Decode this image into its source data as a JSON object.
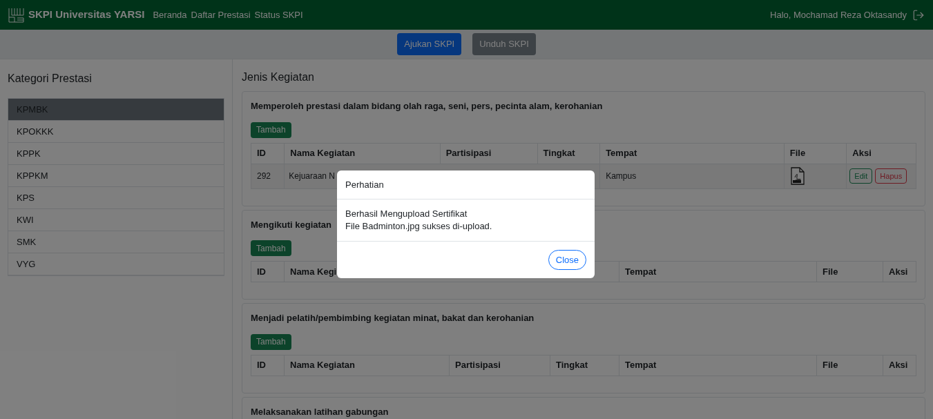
{
  "navbar": {
    "brand": "SKPI Universitas YARSI",
    "links": [
      "Beranda",
      "Daftar Prestasi",
      "Status SKPI"
    ],
    "greeting": "Halo, Mochamad Reza Oktasandy"
  },
  "actions": [
    {
      "label": "Ajukan SKPI",
      "disabled": false
    },
    {
      "label": "Unduh SKPI",
      "disabled": true
    }
  ],
  "sidebar": {
    "title": "Kategori Prestasi",
    "items": [
      {
        "label": "KPMBK",
        "selected": true
      },
      {
        "label": "KPOKKK",
        "selected": false
      },
      {
        "label": "KPPK",
        "selected": false
      },
      {
        "label": "KPPKM",
        "selected": false
      },
      {
        "label": "KPS",
        "selected": false
      },
      {
        "label": "KWI",
        "selected": false
      },
      {
        "label": "SMK",
        "selected": false
      },
      {
        "label": "VYG",
        "selected": false
      }
    ]
  },
  "main": {
    "title": "Jenis Kegiatan",
    "sections": [
      {
        "title": "Memperoleh prestasi dalam bidang olah raga, seni, pers, pecinta alam, kerohanian",
        "add_button": "Tambah",
        "columns": [
          "ID",
          "Nama Kegiatan",
          "Partisipasi",
          "Tingkat",
          "Tempat",
          "File",
          "Aksi"
        ],
        "rows": [
          {
            "id": "292",
            "name": "Kejuaraan N",
            "place": "Kampus",
            "actions": [
              "Edit",
              "Hapus"
            ]
          }
        ]
      },
      {
        "title": "Mengikuti kegiatan",
        "add_button": "Tambah",
        "columns": [
          "ID",
          "Nama Kegi",
          "Tempat",
          "File",
          "Aksi"
        ]
      },
      {
        "title": "Menjadi pelatih/pembimbing kegiatan minat, bakat dan kerohanian",
        "add_button": "Tambah",
        "columns": [
          "ID",
          "Nama Kegiatan",
          "Partisipasi",
          "Tingkat",
          "Tempat",
          "File",
          "Aksi"
        ]
      },
      {
        "title": "Melaksanakan latihan gabungan"
      }
    ]
  },
  "modal": {
    "title": "Perhatian",
    "lines": [
      "Berhasil Mengupload Sertifikat",
      "File Badminton.jpg sukses di-upload."
    ],
    "button": "Close"
  }
}
